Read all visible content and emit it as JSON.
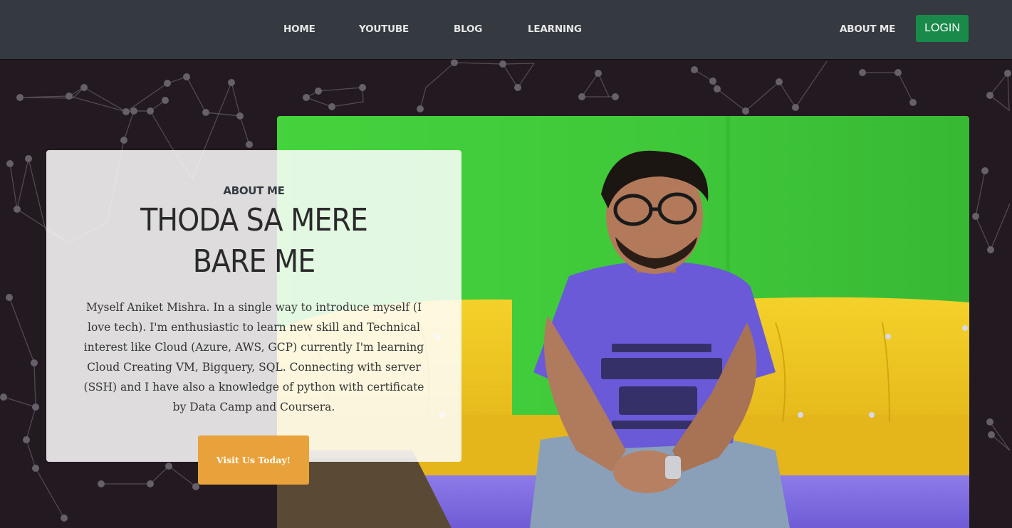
{
  "nav": {
    "home": "HOME",
    "youtube": "YOUTUBE",
    "blog": "BLOG",
    "learning": "LEARNING",
    "about": "ABOUT ME",
    "login": "LOGIN"
  },
  "about": {
    "eyebrow": "ABOUT ME",
    "headline_line1": "THODA SA MERE",
    "headline_line2": "BARE ME",
    "bio": "Myself Aniket Mishra. In a single way to introduce myself (I love tech). I'm enthusiastic to learn new skill and Technical interest like Cloud (Azure, AWS, GCP) currently I'm learning Cloud Creating VM, Bigquery, SQL. Connecting with server (SSH) and I have also a knowledge of python with certificate by Data Camp and Coursera.",
    "cta": "Visit Us Today!"
  },
  "colors": {
    "nav_bg": "#343a40",
    "page_bg": "#221a20",
    "login_green": "#1a8a4a",
    "cta_orange": "#e9a23b",
    "photo_wall_green": "#3cc93a",
    "sofa_yellow": "#f0c21a",
    "shirt_purple": "#6a5ad8"
  }
}
